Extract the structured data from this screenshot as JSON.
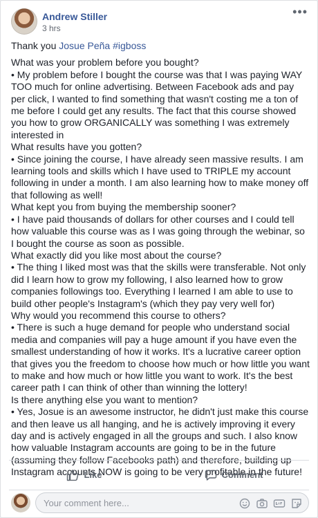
{
  "post": {
    "author": "Andrew Stiller",
    "time": "3 hrs",
    "more_label": "•••",
    "intro": "Thank you",
    "mention": "Josue Peña #igboss",
    "lines": [
      "What was your problem before you bought?",
      "• My problem before I bought the course was that I was paying WAY TOO much for online advertising. Between Facebook ads and pay per click, I wanted to find something that wasn't costing me a ton of me before I could get any results. The fact that this course showed you how to grow ORGANICALLY was something I was extremely interested in",
      "What results have you gotten?",
      "• Since joining the course, I have already seen massive results. I am learning tools and skills which I have used to TRIPLE my account following in under a month. I am also learning how to make money off that following as well!",
      "What kept you from buying the membership sooner?",
      "• I have paid thousands of dollars for other courses and I could tell how valuable this course was as I was going through the webinar, so I bought the course as soon as possible.",
      "What exactly did you like most about the course?",
      "• The thing I liked most was that the skills were transferable. Not only did I learn how to grow my following, I also learned how to grow companies followings too. Everything I learned I am able to use to build other people's Instagram's (which they pay very well for)",
      "Why would you recommend this course to others?",
      "• There is such a huge demand for people who understand social media and companies will pay a huge amount if you have even the smallest understanding of how it works. It's a lucrative career option that gives you the freedom to choose how much or how little you want to make and how much or how little you want to work. It's the best career path I can think of other than winning the lottery!",
      "Is there anything else you want to mention?",
      "• Yes, Josue is an awesome instructor, he didn't just make this course and then leave us all hanging, and he is actively improving it every day and is actively engaged in all the groups and such. I also know how valuable Instagram accounts are going to be in the future (assuming they follow Facebooks path) and therefore, building up Instagram accounts NOW is going to be very profitable in the future!"
    ]
  },
  "actions": {
    "like": "Like",
    "comment": "Comment"
  },
  "composer": {
    "placeholder": "Your comment here...",
    "icons": [
      "emoji-icon",
      "camera-icon",
      "gif-icon",
      "sticker-icon"
    ]
  },
  "colors": {
    "link": "#385898",
    "text": "#1d2129",
    "muted": "#606770"
  }
}
